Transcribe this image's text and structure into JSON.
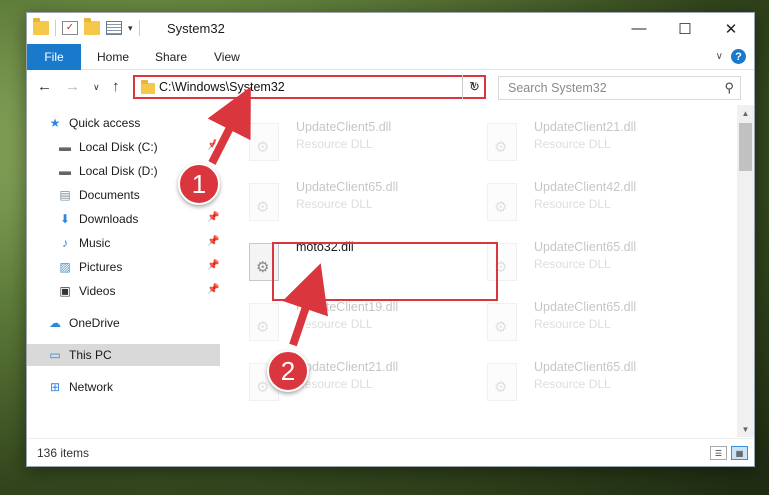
{
  "window": {
    "title": "System32",
    "controls": {
      "minimize": "—",
      "maximize": "☐",
      "close": "✕"
    }
  },
  "ribbon": {
    "file": "File",
    "tabs": [
      "Home",
      "Share",
      "View"
    ],
    "help": "?"
  },
  "address": {
    "path": "C:\\Windows\\System32",
    "search_placeholder": "Search System32"
  },
  "nav": {
    "items": [
      {
        "label": "Quick access",
        "icon": "star-icon",
        "pinned": false
      },
      {
        "label": "Local Disk (C:)",
        "icon": "drive-icon",
        "pinned": true
      },
      {
        "label": "Local Disk (D:)",
        "icon": "drive-icon",
        "pinned": false
      },
      {
        "label": "Documents",
        "icon": "documents-icon",
        "pinned": false
      },
      {
        "label": "Downloads",
        "icon": "download-icon",
        "pinned": true
      },
      {
        "label": "Music",
        "icon": "music-icon",
        "pinned": true
      },
      {
        "label": "Pictures",
        "icon": "pictures-icon",
        "pinned": true
      },
      {
        "label": "Videos",
        "icon": "videos-icon",
        "pinned": true
      },
      {
        "label": "OneDrive",
        "icon": "onedrive-icon",
        "pinned": false
      },
      {
        "label": "This PC",
        "icon": "pc-icon",
        "pinned": false,
        "selected": true
      },
      {
        "label": "Network",
        "icon": "network-icon",
        "pinned": false
      }
    ]
  },
  "files": {
    "type_label": "Resource DLL",
    "left": [
      {
        "name": "UpdateClient5.dll",
        "type": "Resource DLL"
      },
      {
        "name": "UpdateClient65.dll",
        "type": "Resource DLL"
      },
      {
        "name": "moto32.dll",
        "type": ""
      },
      {
        "name": "UpdateClient19.dll",
        "type": "Resource DLL"
      },
      {
        "name": "UpdateClient21.dll",
        "type": "Resource DLL"
      }
    ],
    "right": [
      {
        "name": "UpdateClient21.dll",
        "type": "Resource DLL"
      },
      {
        "name": "UpdateClient42.dll",
        "type": "Resource DLL"
      },
      {
        "name": "UpdateClient65.dll",
        "type": "Resource DLL"
      },
      {
        "name": "UpdateClient65.dll",
        "type": "Resource DLL"
      },
      {
        "name": "UpdateClient65.dll",
        "type": "Resource DLL"
      }
    ]
  },
  "status": {
    "item_count": "136 items"
  },
  "annotations": {
    "step1": "1",
    "step2": "2",
    "color": "#d9363e"
  }
}
